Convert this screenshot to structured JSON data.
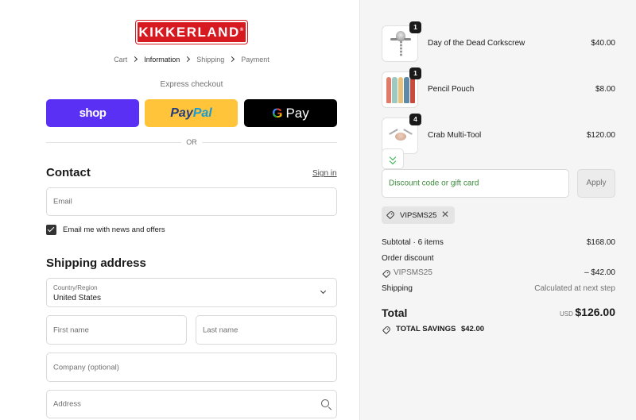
{
  "brand": {
    "logo_text": "KIKKERLAND"
  },
  "breadcrumb": [
    "Cart",
    "Information",
    "Shipping",
    "Payment"
  ],
  "express": {
    "label": "Express checkout",
    "shop": "shop",
    "paypal_a": "Pay",
    "paypal_b": "Pal",
    "gpay_g": "G",
    "gpay_text": "Pay",
    "or": "OR"
  },
  "contact": {
    "heading": "Contact",
    "sign_in": "Sign in",
    "email_placeholder": "Email",
    "newsletter_label": "Email me with news and offers",
    "newsletter_checked": true
  },
  "shipping": {
    "heading": "Shipping address",
    "country_label": "Country/Region",
    "country_value": "United States",
    "first_name": "First name",
    "last_name": "Last name",
    "company": "Company (optional)",
    "address": "Address"
  },
  "cart": {
    "items": [
      {
        "qty": "1",
        "name": "Day of the Dead Corkscrew",
        "price": "$40.00",
        "icon": "corkscrew-image"
      },
      {
        "qty": "1",
        "name": "Pencil Pouch",
        "price": "$8.00",
        "icon": "pencil-pouch-image"
      },
      {
        "qty": "4",
        "name": "Crab Multi-Tool",
        "price": "$120.00",
        "icon": "crab-multi-tool-image"
      }
    ],
    "discount_placeholder": "Discount code or gift card",
    "apply": "Apply",
    "applied_code": "VIPSMS25",
    "subtotal_label": "Subtotal · 6 items",
    "subtotal_value": "$168.00",
    "order_discount_label": "Order discount",
    "discount_code": "VIPSMS25",
    "discount_value": "– $42.00",
    "shipping_label": "Shipping",
    "shipping_value": "Calculated at next step",
    "total_label": "Total",
    "currency": "USD",
    "total_value": "$126.00",
    "savings_label": "TOTAL SAVINGS",
    "savings_value": "$42.00"
  },
  "colors": {
    "shop": "#5a31f4",
    "paypal": "#ffc439",
    "gpay": "#000000",
    "brand": "#d71920",
    "discount_text": "#3d8b3d"
  }
}
